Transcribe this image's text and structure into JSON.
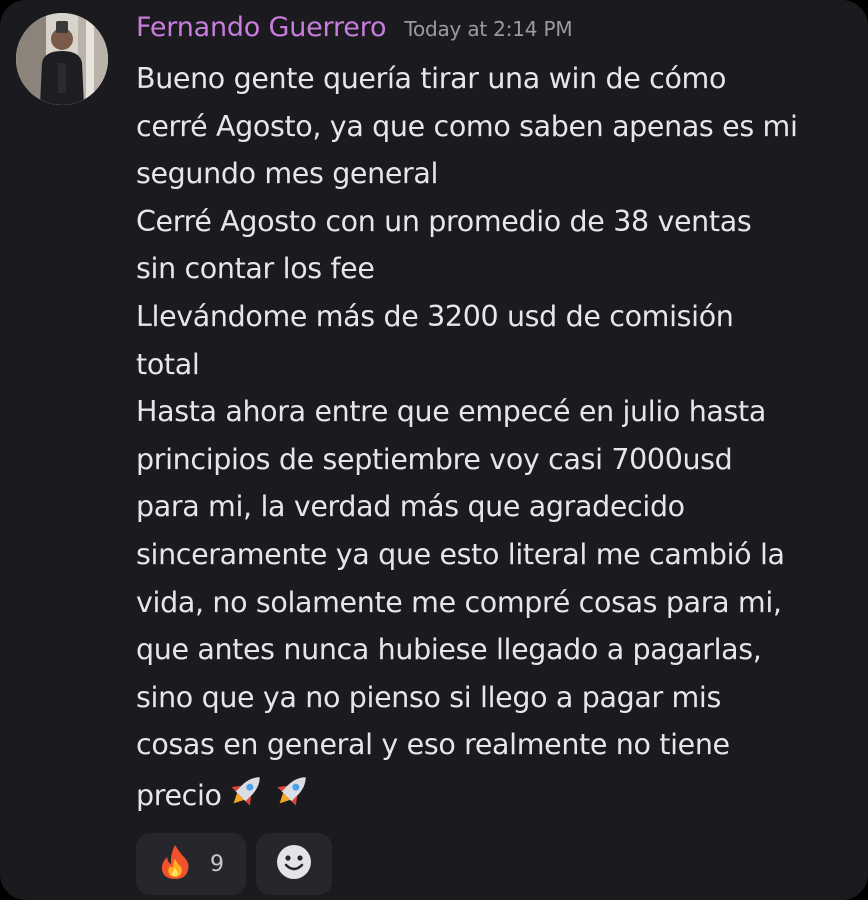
{
  "message": {
    "author": "Fernando Guerrero",
    "timestamp": "Today at 2:14 PM",
    "lines": [
      "Bueno gente quería tirar una win de cómo",
      "cerré Agosto, ya que como saben apenas es mi",
      "segundo mes general",
      "Cerré Agosto con un promedio de 38 ventas",
      "sin contar los fee",
      "Llevándome más de 3200 usd de comisión",
      "total",
      "Hasta ahora entre que empecé en julio hasta",
      "principios de septiembre voy casi 7000usd",
      "para mi, la verdad más que agradecido",
      "sinceramente ya que esto literal me cambió la",
      "vida, no solamente me compré cosas para mi,",
      "que antes nunca hubiese llegado a pagarlas,",
      "sino que ya no pienso si llego a pagar mis",
      "cosas en general y eso realmente no tiene",
      "precio"
    ],
    "inline_emoji": [
      "rocket-icon",
      "rocket-icon"
    ]
  },
  "reactions": [
    {
      "icon": "fire-icon",
      "count": "9"
    },
    {
      "icon": "add-reaction-icon"
    }
  ],
  "colors": {
    "background": "#1b1b1f",
    "author": "#c67ddc",
    "timestamp": "#9a9aa3",
    "text": "#e6e6e9",
    "reaction_bg": "#26262c"
  }
}
